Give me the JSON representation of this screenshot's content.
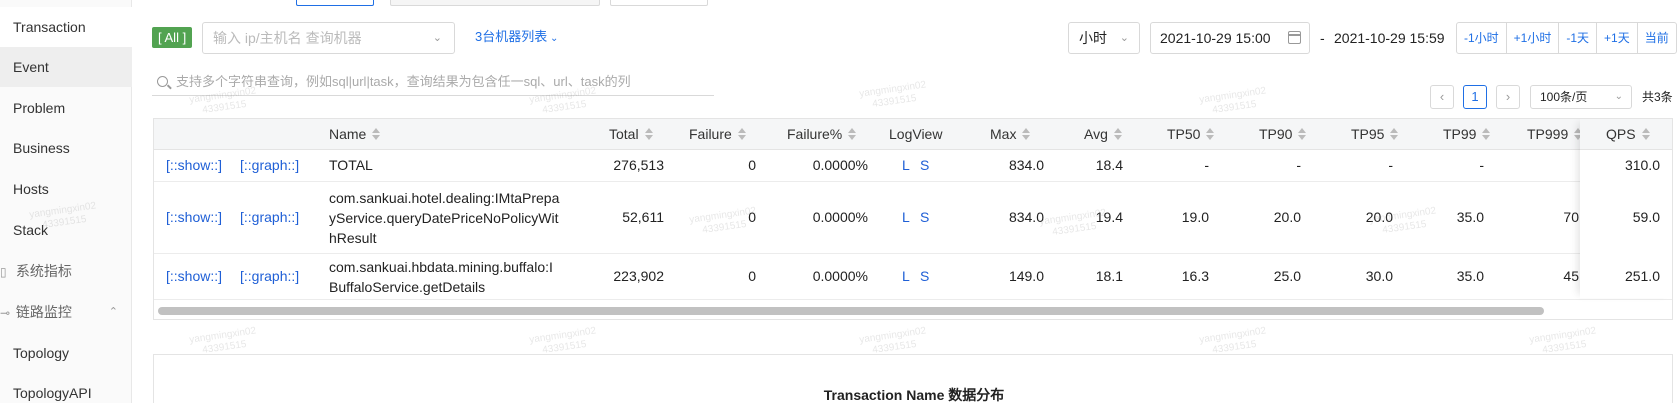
{
  "sidebar": {
    "items": [
      {
        "label": "Transaction",
        "state": "active"
      },
      {
        "label": "Event",
        "state": "hover"
      },
      {
        "label": "Problem"
      },
      {
        "label": "Business"
      },
      {
        "label": "Hosts"
      },
      {
        "label": "Stack"
      }
    ],
    "group_system": {
      "label": "系统指标"
    },
    "group_trace": {
      "label": "链路监控",
      "icon": "link-icon",
      "expanded": true
    },
    "trace_items": [
      {
        "label": "Topology"
      },
      {
        "label": "TopologyAPI"
      }
    ]
  },
  "filters": {
    "all_tag": "[ All ]",
    "machine_placeholder": "输入 ip/主机名 查询机器",
    "machine_list": "3台机器列表",
    "unit": "小时",
    "start": "2021-10-29 15:00",
    "separator": "-",
    "end": "2021-10-29 15:59",
    "steps": [
      "-1小时",
      "+1小时",
      "-1天",
      "+1天",
      "当前"
    ]
  },
  "search": {
    "placeholder": "支持多个字符串查询，例如sql|url|task，查询结果为包含任一sql、url、task的列"
  },
  "pagination": {
    "prev": "‹",
    "current": "1",
    "next": "›",
    "page_size": "100条/页",
    "total": "共3条"
  },
  "table": {
    "headers": {
      "name": "Name",
      "total": "Total",
      "failure": "Failure",
      "failure_pct": "Failure%",
      "logview": "LogView",
      "max": "Max",
      "avg": "Avg",
      "tp50": "TP50",
      "tp90": "TP90",
      "tp95": "TP95",
      "tp99": "TP99",
      "tp999": "TP999",
      "qps": "QPS"
    },
    "rows": [
      {
        "show": "[::show::]",
        "graph": "[::graph::]",
        "name": "TOTAL",
        "total": "276,513",
        "failure": "0",
        "failure_pct": "0.0000%",
        "log_l": "L",
        "log_s": "S",
        "max": "834.0",
        "avg": "18.4",
        "tp50": "-",
        "tp90": "-",
        "tp95": "-",
        "tp99": "-",
        "tp999": "",
        "qps": "310.0"
      },
      {
        "show": "[::show::]",
        "graph": "[::graph::]",
        "name": "com.sankuai.hotel.dealing:IMtaPrepayService.queryDatePriceNoPolicyWithResult",
        "total": "52,611",
        "failure": "0",
        "failure_pct": "0.0000%",
        "log_l": "L",
        "log_s": "S",
        "max": "834.0",
        "avg": "19.4",
        "tp50": "19.0",
        "tp90": "20.0",
        "tp95": "20.0",
        "tp99": "35.0",
        "tp999": "70",
        "qps": "59.0"
      },
      {
        "show": "[::show::]",
        "graph": "[::graph::]",
        "name": "com.sankuai.hbdata.mining.buffalo:IBuffaloService.getDetails",
        "total": "223,902",
        "failure": "0",
        "failure_pct": "0.0000%",
        "log_l": "L",
        "log_s": "S",
        "max": "149.0",
        "avg": "18.1",
        "tp50": "16.3",
        "tp90": "25.0",
        "tp95": "30.0",
        "tp99": "35.0",
        "tp999": "45",
        "qps": "251.0"
      }
    ]
  },
  "chart_section": {
    "title": "Transaction Name 数据分布"
  },
  "watermark": {
    "line1": "yangmingxin02",
    "line2": "43391515"
  },
  "colors": {
    "accent": "#1f6fe5",
    "all_tag": "#52a351",
    "link": "#1f5fd6"
  }
}
